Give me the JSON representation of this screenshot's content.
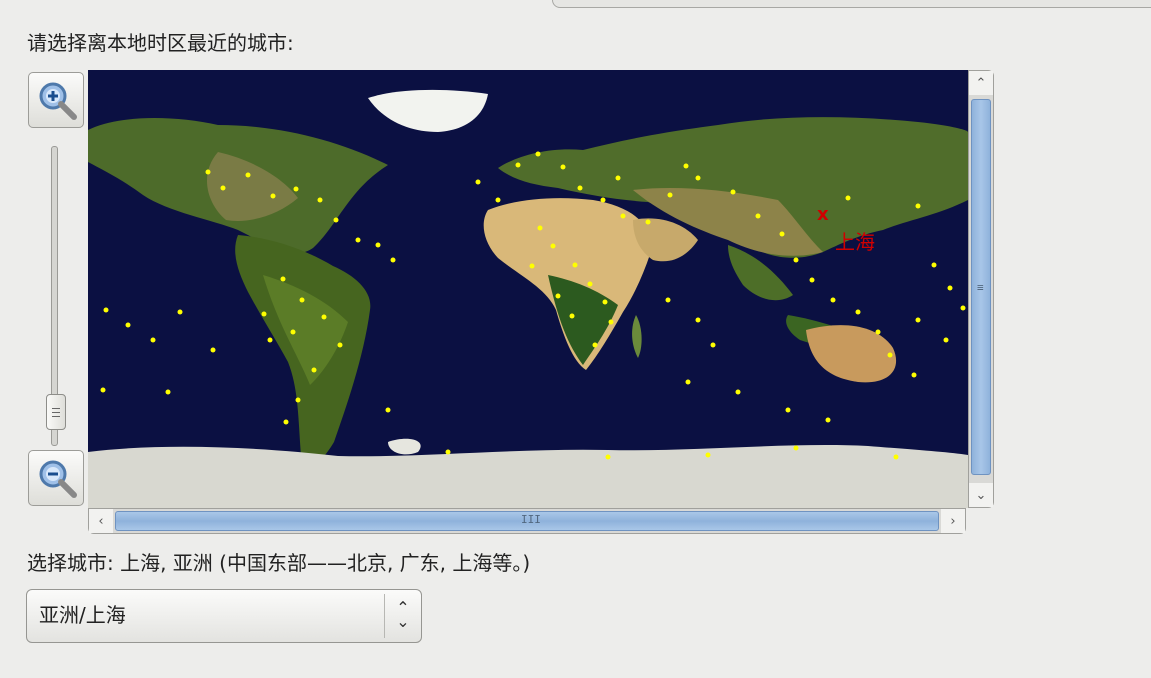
{
  "prompt_text": "请选择离本地时区最近的城市:",
  "map": {
    "selected_city_label": "上海",
    "marker_symbol": "x",
    "selected_color": "#d00000",
    "dot_color": "#ffff00"
  },
  "icons": {
    "zoom_in": "zoom-in-icon",
    "zoom_out": "zoom-out-icon",
    "scroll_up": "chevron-up-icon",
    "scroll_down": "chevron-down-icon",
    "scroll_left": "chevron-left-icon",
    "scroll_right": "chevron-right-icon",
    "combo_arrow": "up-down-icon"
  },
  "selection_text": "选择城市: 上海, 亚洲 (中国东部——北京, 广东, 上海等。)",
  "timezone_combo": {
    "value": "亚洲/上海"
  },
  "zoom_level": 0.17,
  "horizontal_scroll": 0.5,
  "vertical_scroll": 0.5
}
